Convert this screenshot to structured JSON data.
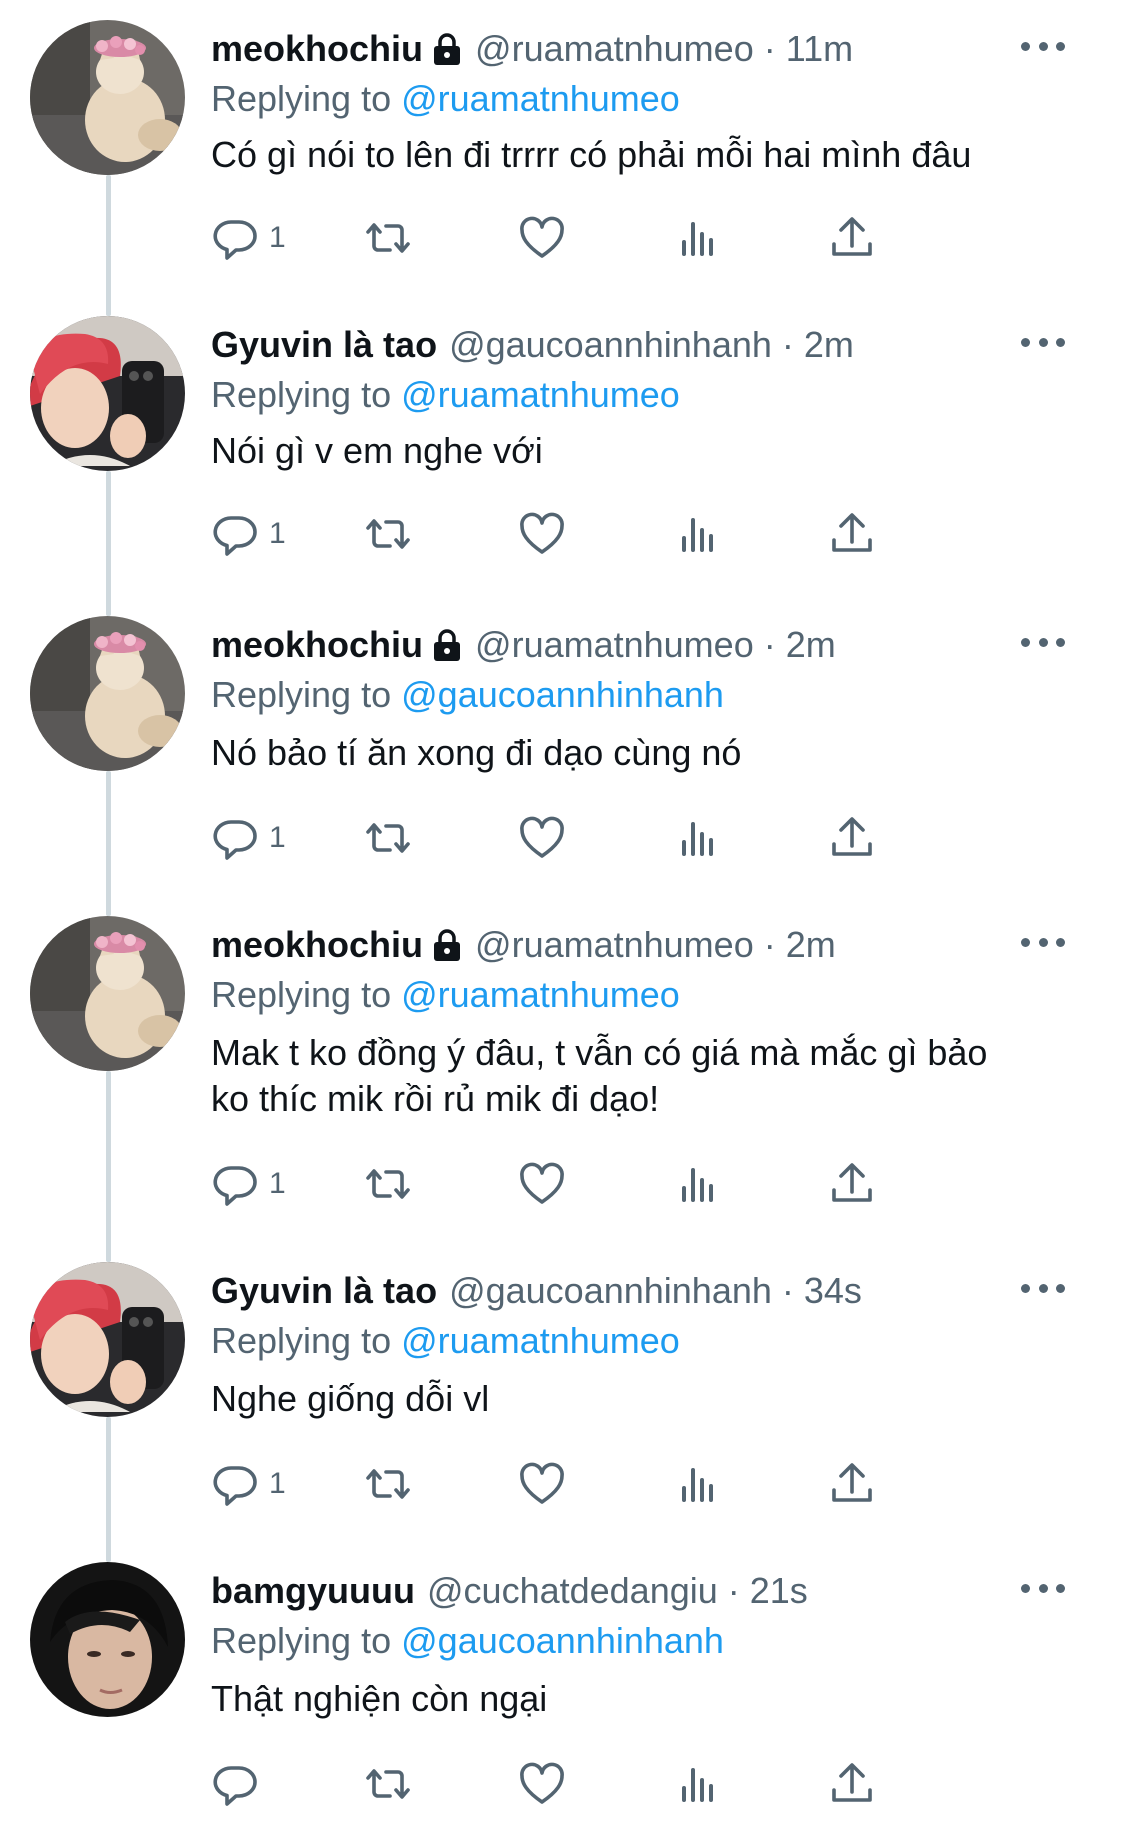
{
  "thread": {
    "tweets": [
      {
        "name": "meokhochiu",
        "protected": true,
        "handle": "@ruamatnhumeo",
        "time": "11m",
        "replying_label": "Replying to",
        "replying_to": "@ruamatnhumeo",
        "text_lines": [
          "Có gì nói to lên đi trrrr có phải mỗi hai mình đâu"
        ],
        "reply_count": "1",
        "avatar": "cat-with-flower-crown"
      },
      {
        "name": "Gyuvin là tao",
        "protected": false,
        "handle": "@gaucoannhinhanh",
        "time": "2m",
        "replying_label": "Replying to",
        "replying_to": "@ruamatnhumeo",
        "text_lines": [
          "Nói gì v em nghe với"
        ],
        "reply_count": "1",
        "avatar": "red-hair-mirror-selfie"
      },
      {
        "name": "meokhochiu",
        "protected": true,
        "handle": "@ruamatnhumeo",
        "time": "2m",
        "replying_label": "Replying to",
        "replying_to": "@gaucoannhinhanh",
        "text_lines": [
          "Nó bảo tí ăn xong đi dạo cùng nó"
        ],
        "reply_count": "1",
        "avatar": "cat-with-flower-crown"
      },
      {
        "name": "meokhochiu",
        "protected": true,
        "handle": "@ruamatnhumeo",
        "time": "2m",
        "replying_label": "Replying to",
        "replying_to": "@ruamatnhumeo",
        "text_lines": [
          "Mak t ko đồng ý đâu, t vẫn có giá mà mắc gì bảo",
          "ko thíc mik rồi rủ mik đi dạo!"
        ],
        "reply_count": "1",
        "avatar": "cat-with-flower-crown"
      },
      {
        "name": "Gyuvin là tao",
        "protected": false,
        "handle": "@gaucoannhinhanh",
        "time": "34s",
        "replying_label": "Replying to",
        "replying_to": "@ruamatnhumeo",
        "text_lines": [
          "Nghe giống dỗi vl"
        ],
        "reply_count": "1",
        "avatar": "red-hair-mirror-selfie"
      },
      {
        "name": "bamgyuuuu",
        "protected": false,
        "handle": "@cuchatdedangiu",
        "time": "21s",
        "replying_label": "Replying to",
        "replying_to": "@gaucoannhinhanh",
        "text_lines": [
          "Thật nghiện còn ngại"
        ],
        "reply_count": "",
        "avatar": "dark-hair-portrait"
      }
    ]
  },
  "separator": "·",
  "icons": {
    "protected": "lock-icon",
    "reply": "reply-icon",
    "retweet": "retweet-icon",
    "like": "heart-icon",
    "views": "views-icon",
    "share": "share-icon",
    "more": "more-icon"
  },
  "colors": {
    "text": "#0f1419",
    "secondary": "#536471",
    "link": "#1d9bf0",
    "thread_line": "#cfd9de"
  }
}
